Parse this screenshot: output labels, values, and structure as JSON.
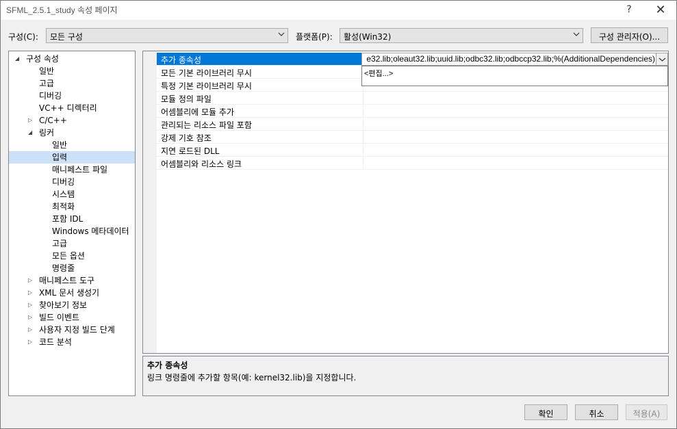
{
  "window": {
    "title": "SFML_2.5.1_study 속성 페이지",
    "help_label": "?",
    "close_label": "✕"
  },
  "config": {
    "label": "구성(C):",
    "value": "모든 구성",
    "platform_label": "플랫폼(P):",
    "platform_value": "활성(Win32)",
    "manager_label": "구성 관리자(O)..."
  },
  "tree": {
    "items": [
      {
        "label": "구성 속성",
        "twisty": "◢"
      },
      {
        "label": "일반"
      },
      {
        "label": "고급"
      },
      {
        "label": "디버깅"
      },
      {
        "label": "VC++ 디렉터리"
      },
      {
        "label": "C/C++",
        "twisty": "▷"
      },
      {
        "label": "링커",
        "twisty": "◢"
      },
      {
        "label": "일반"
      },
      {
        "label": "입력"
      },
      {
        "label": "매니페스트 파일"
      },
      {
        "label": "디버깅"
      },
      {
        "label": "시스템"
      },
      {
        "label": "최적화"
      },
      {
        "label": "포함 IDL"
      },
      {
        "label": "Windows 메타데이터"
      },
      {
        "label": "고급"
      },
      {
        "label": "모든 옵션"
      },
      {
        "label": "명령줄"
      },
      {
        "label": "매니페스트 도구",
        "twisty": "▷"
      },
      {
        "label": "XML 문서 생성기",
        "twisty": "▷"
      },
      {
        "label": "찾아보기 정보",
        "twisty": "▷"
      },
      {
        "label": "빌드 이벤트",
        "twisty": "▷"
      },
      {
        "label": "사용자 지정 빌드 단계",
        "twisty": "▷"
      },
      {
        "label": "코드 분석",
        "twisty": "▷"
      }
    ]
  },
  "grid": {
    "properties": [
      {
        "name": "추가 종속성"
      },
      {
        "name": "모든 기본 라이브러리 무시"
      },
      {
        "name": "특정 기본 라이브러리 무시"
      },
      {
        "name": "모듈 정의 파일"
      },
      {
        "name": "어셈블리에 모듈 추가"
      },
      {
        "name": "관리되는 리소스 파일 포함"
      },
      {
        "name": "강제 기호 참조"
      },
      {
        "name": "지연 로드된 DLL"
      },
      {
        "name": "어셈블리와 리소스 링크"
      }
    ],
    "selected_value": "e32.lib;oleaut32.lib;uuid.lib;odbc32.lib;odbccp32.lib;%(AdditionalDependencies)",
    "dropdown_item": "<편집...>"
  },
  "description": {
    "title": "추가 종속성",
    "text": "링크 명령줄에 추가할 항목(예: kernel32.lib)을 지정합니다."
  },
  "buttons": {
    "ok": "확인",
    "cancel": "취소",
    "apply": "적용(A)"
  }
}
